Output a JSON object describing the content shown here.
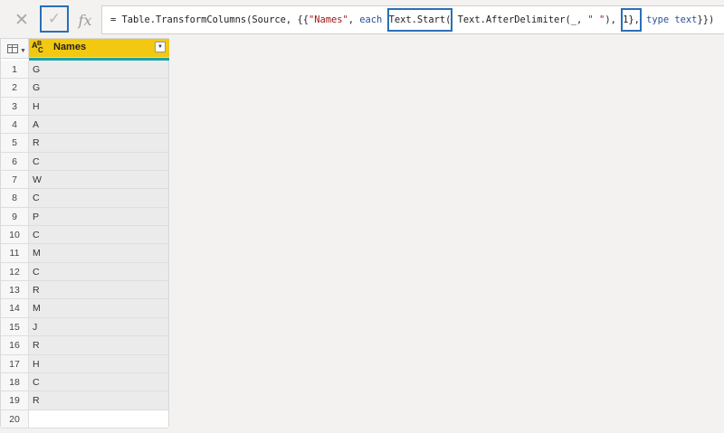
{
  "toolbar": {
    "cancel_icon": "close-icon",
    "commit_icon": "checkmark-icon",
    "fx_label": "fx"
  },
  "formula": {
    "parts": [
      "= Table.TransformColumns(Source, {{",
      "\"Names\"",
      ", ",
      "each",
      " ",
      "Text.Start(",
      " Text.AfterDelimiter(_, ",
      "\" \"",
      "), ",
      "1},",
      " ",
      "type text",
      "}})"
    ]
  },
  "table": {
    "column_header": "Names",
    "column_type_icon": "text-type-icon",
    "rows": [
      {
        "num": "1",
        "value": "G"
      },
      {
        "num": "2",
        "value": "G"
      },
      {
        "num": "3",
        "value": "H"
      },
      {
        "num": "4",
        "value": "A"
      },
      {
        "num": "5",
        "value": "R"
      },
      {
        "num": "6",
        "value": "C"
      },
      {
        "num": "7",
        "value": "W"
      },
      {
        "num": "8",
        "value": "C"
      },
      {
        "num": "9",
        "value": "P"
      },
      {
        "num": "10",
        "value": "C"
      },
      {
        "num": "11",
        "value": "M"
      },
      {
        "num": "12",
        "value": "C"
      },
      {
        "num": "13",
        "value": "R"
      },
      {
        "num": "14",
        "value": "M"
      },
      {
        "num": "15",
        "value": "J"
      },
      {
        "num": "16",
        "value": "R"
      },
      {
        "num": "17",
        "value": "H"
      },
      {
        "num": "18",
        "value": "C"
      },
      {
        "num": "19",
        "value": "R"
      },
      {
        "num": "20",
        "value": ""
      }
    ]
  },
  "colors": {
    "header_yellow": "#f2c811",
    "quality_bar": "#1ba3a6",
    "highlight_box": "#2a6fb5",
    "string": "#a31515",
    "keyword": "#2a4f9a"
  }
}
